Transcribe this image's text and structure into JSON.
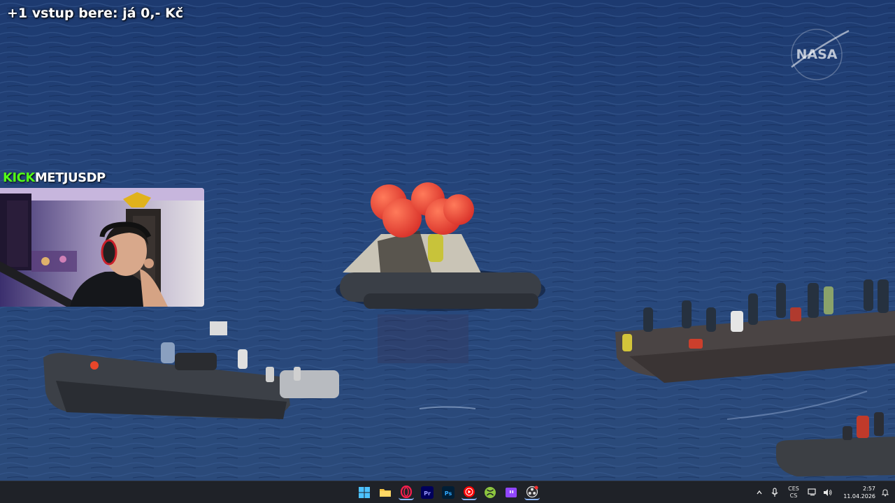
{
  "overlay": {
    "text": "+1 vstup bere: já 0,- Kč"
  },
  "streamer": {
    "platform": "KICK",
    "username": "METJUSDP"
  },
  "watermark": {
    "logo_text": "NASA"
  },
  "taskbar": {
    "apps": [
      {
        "name": "windows-start",
        "label": "Start"
      },
      {
        "name": "file-explorer",
        "label": "File Explorer"
      },
      {
        "name": "opera-gx",
        "label": "Opera GX"
      },
      {
        "name": "premiere-pro",
        "label": "Pr"
      },
      {
        "name": "photoshop",
        "label": "Ps"
      },
      {
        "name": "youtube-music",
        "label": "YouTube Music"
      },
      {
        "name": "xbox",
        "label": "Xbox"
      },
      {
        "name": "twitch",
        "label": "Twitch"
      },
      {
        "name": "obs",
        "label": "OBS"
      }
    ],
    "tray": {
      "language_top": "CES",
      "language_bottom": "CS",
      "time": "2:57",
      "date": "11.04.2026"
    }
  },
  "colors": {
    "kick_green": "#53fc18",
    "taskbar_bg": "#1f2228",
    "ocean": "#26467a"
  }
}
